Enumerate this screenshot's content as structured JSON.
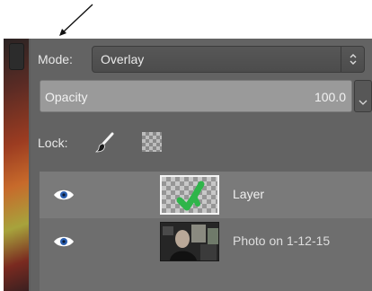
{
  "layer_options": {
    "mode_label": "Mode:",
    "mode_value": "Overlay",
    "opacity_label": "Opacity",
    "opacity_value": "100.0",
    "opacity_fraction": 1.0,
    "lock_label": "Lock:",
    "lock_icons": [
      "paintbrush-icon",
      "checkerboard-icon"
    ]
  },
  "layers": [
    {
      "name": "Layer",
      "thumbnail": "transparent-green-stroke",
      "visible": true,
      "selected": true
    },
    {
      "name": "Photo on 1-12-15",
      "thumbnail": "photo-thumbnail",
      "visible": true,
      "selected": false
    }
  ],
  "colors": {
    "panel_bg": "#636363",
    "stroke_green": "#2fb54a"
  }
}
